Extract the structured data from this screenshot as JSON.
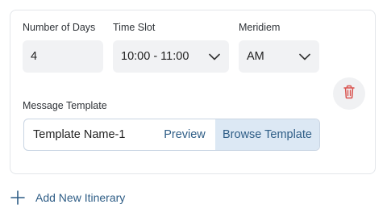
{
  "form": {
    "days": {
      "label": "Number of Days",
      "value": "4"
    },
    "time_slot": {
      "label": "Time Slot",
      "value": "10:00 - 11:00",
      "icon": "chevron-down-icon"
    },
    "meridiem": {
      "label": "Meridiem",
      "value": "AM",
      "icon": "chevron-down-icon"
    },
    "delete": {
      "icon": "trash-icon",
      "color": "#d9534f"
    },
    "template": {
      "label": "Message Template",
      "name": "Template Name-1",
      "preview_label": "Preview",
      "browse_label": "Browse Template"
    }
  },
  "add_itinerary": {
    "icon": "plus-icon",
    "label": "Add New Itinerary"
  },
  "colors": {
    "accent": "#2e5d86",
    "browse_bg": "#dce8f4",
    "field_bg": "#f1f2f4",
    "danger": "#d9534f"
  }
}
